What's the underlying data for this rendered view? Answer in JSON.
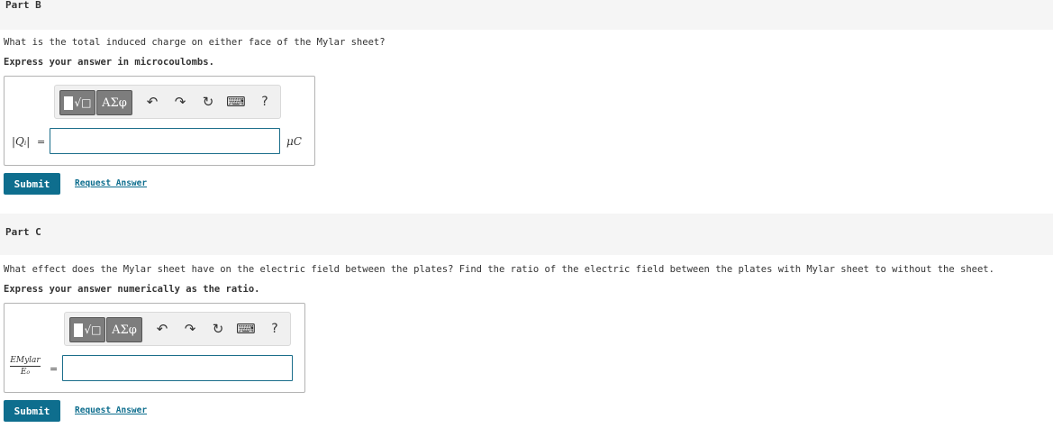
{
  "partB": {
    "title": "Part B",
    "question": "What is the total induced charge on either face of the Mylar sheet?",
    "instruction": "Express your answer in microcoulombs.",
    "variable_label": "|Qᵢ|",
    "equals": "=",
    "input_value": "",
    "unit": "μC",
    "submit_label": "Submit",
    "request_label": "Request Answer"
  },
  "partC": {
    "title": "Part C",
    "question": "What effect does the Mylar sheet have on the electric field between the plates? Find the ratio of the electric field between the plates with Mylar sheet to without the sheet.",
    "instruction": "Express your answer numerically as the ratio.",
    "fraction_numerator": "EMylar",
    "fraction_denominator": "E₀",
    "equals": "=",
    "input_value": "",
    "submit_label": "Submit",
    "request_label": "Request Answer"
  },
  "toolbar": {
    "templates_icon": "templates-icon",
    "greek_label": "ΑΣφ",
    "undo_glyph": "↶",
    "redo_glyph": "↷",
    "reset_glyph": "↻",
    "keyboard_glyph": "⌨",
    "help_glyph": "?"
  },
  "colors": {
    "accent": "#0e6e8e",
    "header_bg": "#f5f5f5",
    "toolbar_button": "#7d7d7d"
  }
}
